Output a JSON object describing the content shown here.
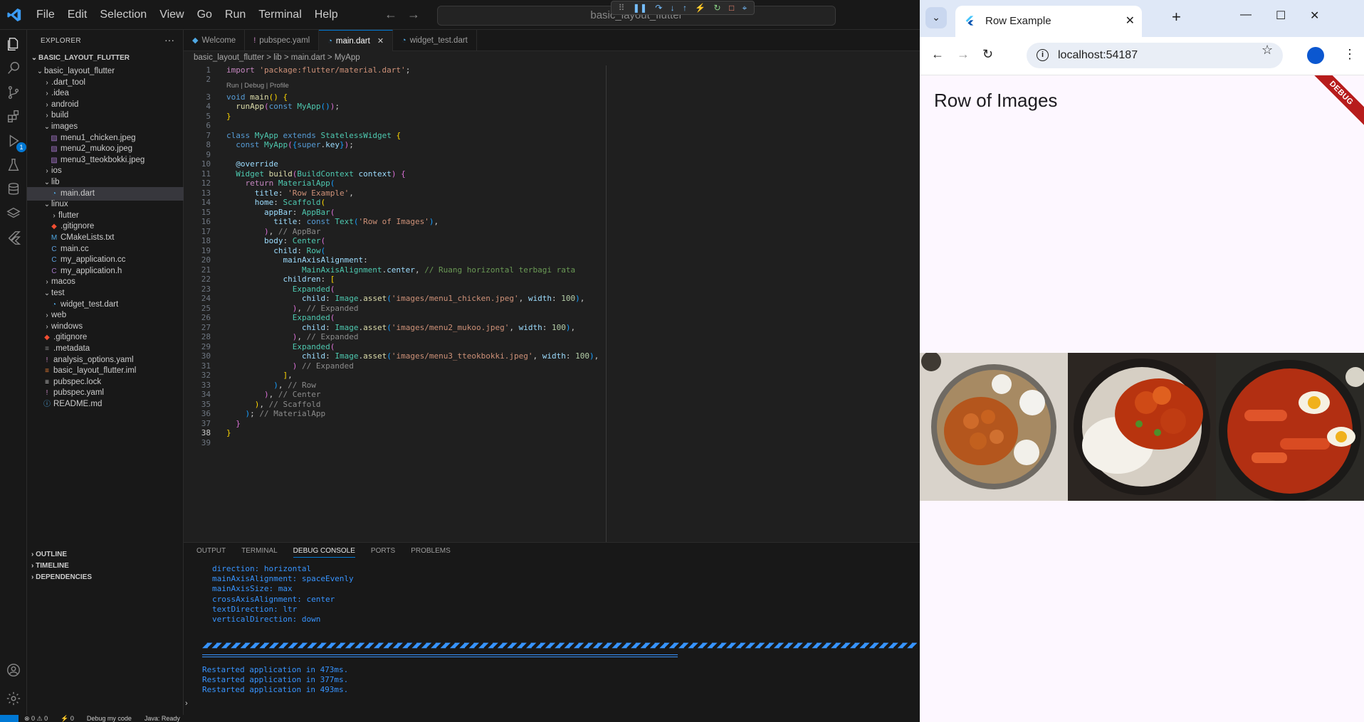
{
  "vscode": {
    "menu": [
      "File",
      "Edit",
      "Selection",
      "View",
      "Go",
      "Run",
      "Terminal",
      "Help"
    ],
    "command_center": "basic_layout_flutter",
    "explorer_title": "EXPLORER",
    "project": "BASIC_LAYOUT_FLUTTER",
    "tree": [
      {
        "label": "basic_layout_flutter",
        "kind": "folder-open",
        "depth": 0
      },
      {
        "label": ".dart_tool",
        "kind": "folder",
        "depth": 1
      },
      {
        "label": ".idea",
        "kind": "folder",
        "depth": 1
      },
      {
        "label": "android",
        "kind": "folder",
        "depth": 1
      },
      {
        "label": "build",
        "kind": "folder",
        "depth": 1
      },
      {
        "label": "images",
        "kind": "folder-open",
        "depth": 1
      },
      {
        "label": "menu1_chicken.jpeg",
        "kind": "image",
        "depth": 2
      },
      {
        "label": "menu2_mukoo.jpeg",
        "kind": "image",
        "depth": 2
      },
      {
        "label": "menu3_tteokbokki.jpeg",
        "kind": "image",
        "depth": 2
      },
      {
        "label": "ios",
        "kind": "folder",
        "depth": 1
      },
      {
        "label": "lib",
        "kind": "folder-open",
        "depth": 1
      },
      {
        "label": "main.dart",
        "kind": "dart",
        "depth": 2,
        "selected": true
      },
      {
        "label": "linux",
        "kind": "folder-open",
        "depth": 1
      },
      {
        "label": "flutter",
        "kind": "folder",
        "depth": 2
      },
      {
        "label": ".gitignore",
        "kind": "git",
        "depth": 2
      },
      {
        "label": "CMakeLists.txt",
        "kind": "cmake",
        "depth": 2
      },
      {
        "label": "main.cc",
        "kind": "cpp",
        "depth": 2
      },
      {
        "label": "my_application.cc",
        "kind": "cpp",
        "depth": 2
      },
      {
        "label": "my_application.h",
        "kind": "header",
        "depth": 2
      },
      {
        "label": "macos",
        "kind": "folder",
        "depth": 1
      },
      {
        "label": "test",
        "kind": "folder-open",
        "depth": 1
      },
      {
        "label": "widget_test.dart",
        "kind": "dart",
        "depth": 2
      },
      {
        "label": "web",
        "kind": "folder",
        "depth": 1
      },
      {
        "label": "windows",
        "kind": "folder",
        "depth": 1
      },
      {
        "label": ".gitignore",
        "kind": "git",
        "depth": 1
      },
      {
        "label": ".metadata",
        "kind": "meta",
        "depth": 1
      },
      {
        "label": "analysis_options.yaml",
        "kind": "yaml",
        "depth": 1
      },
      {
        "label": "basic_layout_flutter.iml",
        "kind": "iml",
        "depth": 1
      },
      {
        "label": "pubspec.lock",
        "kind": "lock",
        "depth": 1
      },
      {
        "label": "pubspec.yaml",
        "kind": "yaml",
        "depth": 1
      },
      {
        "label": "README.md",
        "kind": "info",
        "depth": 1
      }
    ],
    "sidebar_footer": [
      "OUTLINE",
      "TIMELINE",
      "DEPENDENCIES"
    ],
    "tabs": [
      {
        "label": "Welcome",
        "active": false
      },
      {
        "label": "pubspec.yaml",
        "active": false
      },
      {
        "label": "main.dart",
        "active": true
      },
      {
        "label": "widget_test.dart",
        "active": false
      }
    ],
    "breadcrumb": "basic_layout_flutter > lib > main.dart > MyApp",
    "codelens": "Run | Debug | Profile",
    "current_line": 38,
    "panel_tabs": [
      "OUTPUT",
      "TERMINAL",
      "DEBUG CONSOLE",
      "PORTS",
      "PROBLEMS"
    ],
    "active_panel_tab": "DEBUG CONSOLE",
    "console_props": [
      "direction: horizontal",
      "mainAxisAlignment: spaceEvenly",
      "mainAxisSize: max",
      "crossAxisAlignment: center",
      "textDirection: ltr",
      "verticalDirection: down"
    ],
    "console_logs": [
      "Restarted application in 473ms.",
      "Restarted application in 377ms.",
      "Restarted application in 493ms."
    ],
    "status": [
      "⊗ 0 ⚠ 0",
      "⚡ 0",
      "Debug my code",
      "Java: Ready"
    ],
    "debug_badge": "1"
  },
  "browser": {
    "tab_title": "Row Example",
    "url": "localhost:54187",
    "app_title": "Row of Images",
    "debug_label": "DEBUG",
    "images": [
      "menu1_chicken",
      "menu2_mukoo",
      "menu3_tteokbokki"
    ]
  }
}
